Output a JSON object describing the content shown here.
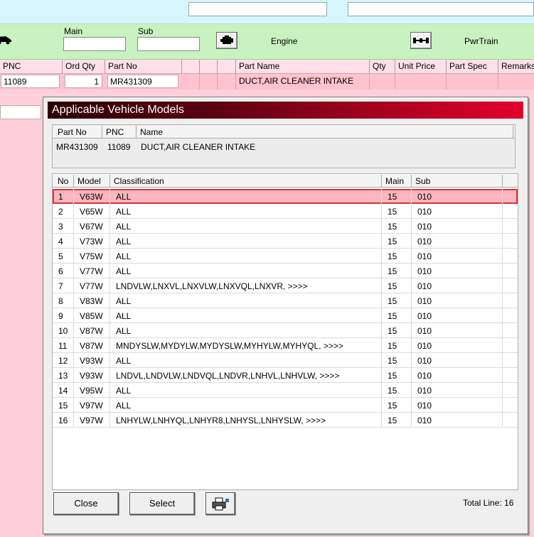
{
  "toolbar": {
    "main_label": "Main",
    "sub_label": "Sub",
    "engine_label": "Engine",
    "pwrtrain_label": "PwrTrain"
  },
  "parts_table": {
    "headers": [
      "PNC",
      "Ord Qty",
      "Part No",
      "",
      "",
      "",
      "Part Name",
      "Qty",
      "Unit Price",
      "Part Spec",
      "Remarks"
    ],
    "row": {
      "pnc": "11089",
      "ord_qty": "1",
      "part_no": "MR431309",
      "part_name": "DUCT,AIR CLEANER INTAKE"
    }
  },
  "dialog": {
    "title": "Applicable Vehicle Models",
    "info_headers": [
      "Part No",
      "PNC",
      "Name"
    ],
    "info_row": {
      "part_no": "MR431309",
      "pnc": "11089",
      "name": "DUCT,AIR CLEANER INTAKE"
    },
    "list_headers": [
      "No",
      "Model",
      "Classification",
      "Main",
      "Sub"
    ],
    "rows": [
      {
        "no": "1",
        "model": "V63W",
        "classification": "ALL",
        "main": "15",
        "sub": "010"
      },
      {
        "no": "2",
        "model": "V65W",
        "classification": "ALL",
        "main": "15",
        "sub": "010"
      },
      {
        "no": "3",
        "model": "V67W",
        "classification": "ALL",
        "main": "15",
        "sub": "010"
      },
      {
        "no": "4",
        "model": "V73W",
        "classification": "ALL",
        "main": "15",
        "sub": "010"
      },
      {
        "no": "5",
        "model": "V75W",
        "classification": "ALL",
        "main": "15",
        "sub": "010"
      },
      {
        "no": "6",
        "model": "V77W",
        "classification": "ALL",
        "main": "15",
        "sub": "010"
      },
      {
        "no": "7",
        "model": "V77W",
        "classification": "LNDVLW,LNXVL,LNXVLW,LNXVQL,LNXVR,  >>>>",
        "main": "15",
        "sub": "010"
      },
      {
        "no": "8",
        "model": "V83W",
        "classification": "ALL",
        "main": "15",
        "sub": "010"
      },
      {
        "no": "9",
        "model": "V85W",
        "classification": "ALL",
        "main": "15",
        "sub": "010"
      },
      {
        "no": "10",
        "model": "V87W",
        "classification": "ALL",
        "main": "15",
        "sub": "010"
      },
      {
        "no": "11",
        "model": "V87W",
        "classification": "MNDYSLW,MYDYLW,MYDYSLW,MYHYLW,MYHYQL,  >>>>",
        "main": "15",
        "sub": "010"
      },
      {
        "no": "12",
        "model": "V93W",
        "classification": "ALL",
        "main": "15",
        "sub": "010"
      },
      {
        "no": "13",
        "model": "V93W",
        "classification": "LNDVL,LNDVLW,LNDVQL,LNDVR,LNHVL,LNHVLW,  >>>>",
        "main": "15",
        "sub": "010"
      },
      {
        "no": "14",
        "model": "V95W",
        "classification": "ALL",
        "main": "15",
        "sub": "010"
      },
      {
        "no": "15",
        "model": "V97W",
        "classification": "ALL",
        "main": "15",
        "sub": "010"
      },
      {
        "no": "16",
        "model": "V97W",
        "classification": "LNHYLW,LNHYQL,LNHYR8,LNHYSL,LNHYSLW,  >>>>",
        "main": "15",
        "sub": "010"
      }
    ],
    "close_label": "Close",
    "select_label": "Select",
    "total_line": "Total Line: 16"
  },
  "icons": {
    "car": "car-icon",
    "engine": "engine-icon",
    "powertrain": "powertrain-icon",
    "print": "print-icon"
  },
  "colors": {
    "title_gradient_start": "#2a0006",
    "title_gradient_end": "#e4002d",
    "selected_row": "#ffb6bf",
    "toolbar_green": "#c8f2c0",
    "background_pink": "#ffd0dc"
  }
}
